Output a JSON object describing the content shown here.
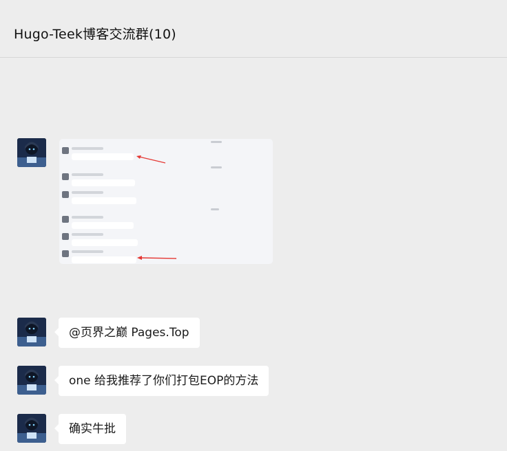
{
  "chat": {
    "title": "Hugo-Teek博客交流群(10)"
  },
  "messages": [
    {
      "type": "image"
    },
    {
      "type": "text",
      "text": "@页界之巅 Pages.Top"
    },
    {
      "type": "text",
      "text": "one 给我推荐了你们打包EOP的方法"
    },
    {
      "type": "text",
      "text": "确实牛批"
    }
  ],
  "colors": {
    "background": "#ededed",
    "bubble": "#ffffff",
    "annotation_arrow": "#e53935"
  },
  "icons": [
    "avatar-image",
    "bot-icon"
  ]
}
